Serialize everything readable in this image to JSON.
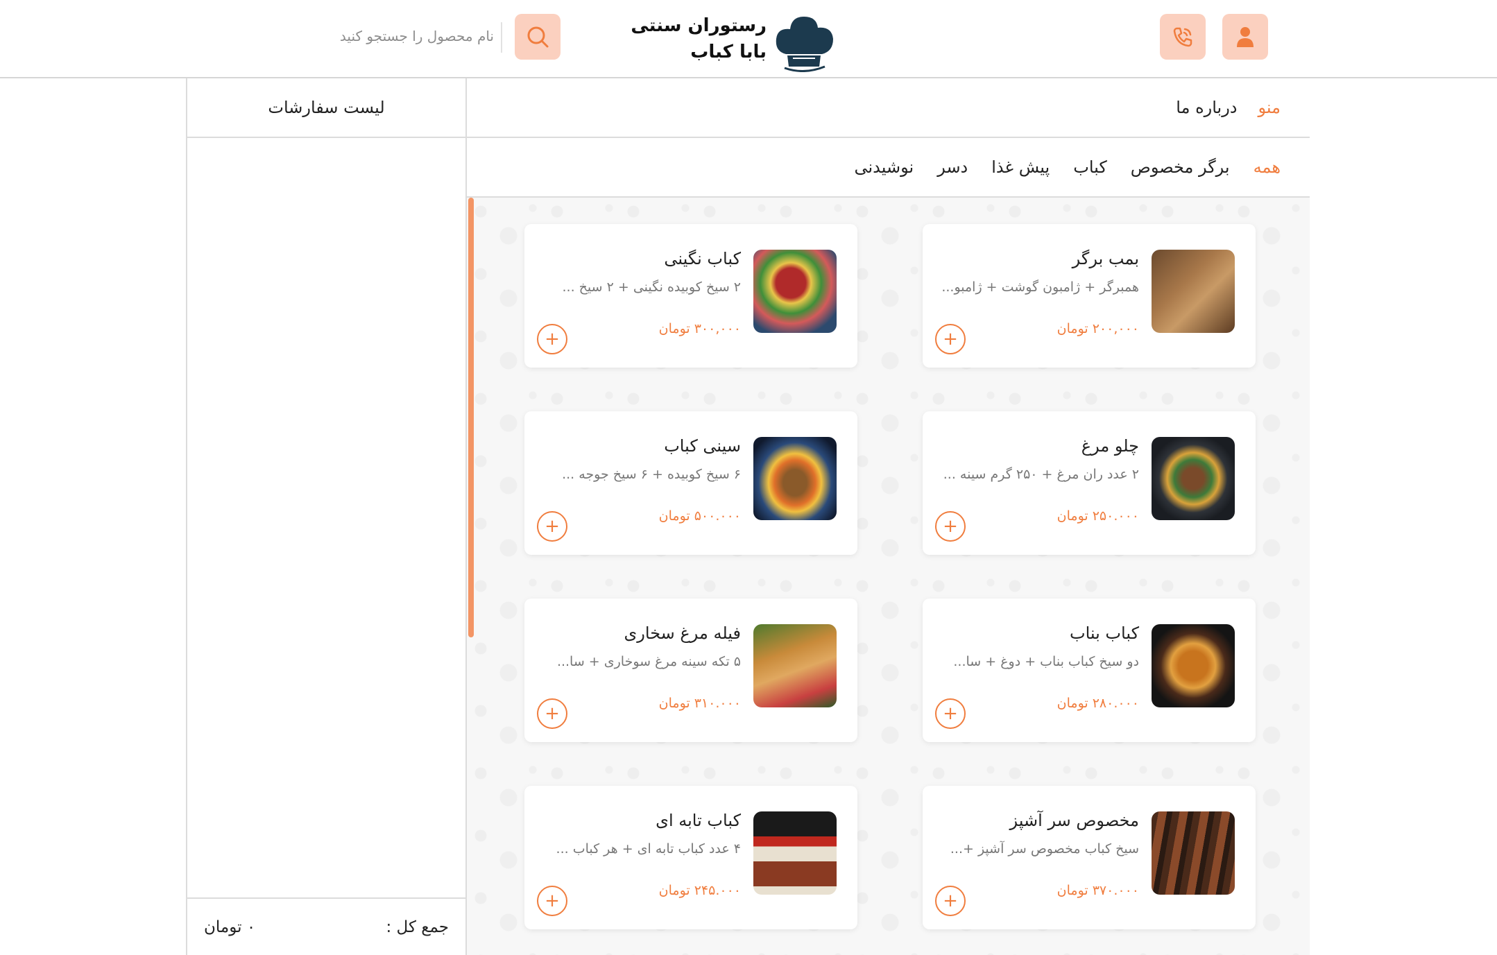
{
  "header": {
    "logo_line1": "رستوران سنتی",
    "logo_line2": "بابا کباب",
    "search_placeholder": "نام محصول را جستجو کنید",
    "icons": {
      "user": "user-icon",
      "phone": "phone-icon",
      "search": "search-icon",
      "logo": "chef-hat-icon"
    }
  },
  "nav": {
    "menu": "منو",
    "about": "درباره ما"
  },
  "categories": [
    "همه",
    "برگر مخصوص",
    "کباب",
    "پیش غذا",
    "دسر",
    "نوشیدنی"
  ],
  "orders": {
    "title": "لیست سفارشات",
    "total_label": "جمع کل :",
    "total_value": "۰ تومان"
  },
  "products": [
    {
      "name": "بمب برگر",
      "desc": "همبرگر + ژامبون گوشت + ژامبو...",
      "price": "۲۰۰,۰۰۰ تومان"
    },
    {
      "name": "کباب نگینی",
      "desc": "۲ سیخ کوبیده نگینی + ۲ سیخ ...",
      "price": "۳۰۰,۰۰۰ تومان"
    },
    {
      "name": "چلو مرغ",
      "desc": "۲ عدد ران مرغ + ۲۵۰ گرم سینه ...",
      "price": "۲۵۰.۰۰۰ تومان"
    },
    {
      "name": "سینی کباب",
      "desc": "۶ سیخ کوبیده + ۶ سیخ جوجه ...",
      "price": "۵۰۰.۰۰۰ تومان"
    },
    {
      "name": "کباب بناب",
      "desc": "دو سیخ کباب بناب + دوغ + سا...",
      "price": "۲۸۰.۰۰۰ تومان"
    },
    {
      "name": "فیله مرغ سخاری",
      "desc": "۵ تکه سینه مرغ سوخاری + سا...",
      "price": "۳۱۰.۰۰۰ تومان"
    },
    {
      "name": "مخصوص سر آشپز",
      "desc": "سیخ کباب مخصوص سر آشپز +...",
      "price": "۳۷۰.۰۰۰ تومان"
    },
    {
      "name": "کباب تابه ای",
      "desc": "۴ عدد کباب تابه ای + هر کباب ...",
      "price": "۲۴۵.۰۰۰ تومان"
    }
  ],
  "add_label": "+",
  "colors": {
    "accent": "#f07d3e",
    "accent_light": "#fbd0bf",
    "scrollbar": "#f39565"
  }
}
